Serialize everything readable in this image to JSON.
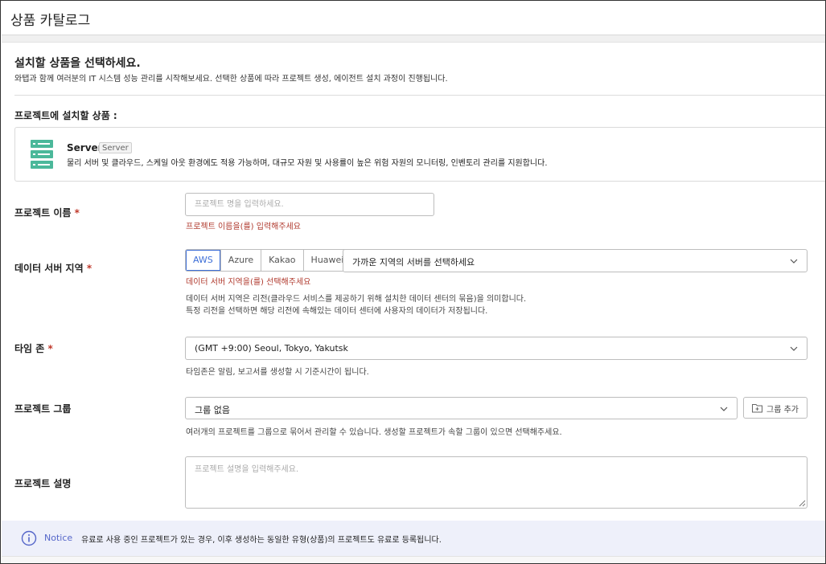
{
  "app": {
    "title": "상품 카탈로그"
  },
  "intro": {
    "heading": "설치할 상품을 선택하세요.",
    "subheading": "와탭과 함께 여러분의 IT 시스템 성능 관리를 시작해보세요. 선택한 상품에 따라 프로젝트 생성, 에이전트 설치 과정이 진행됩니다."
  },
  "install": {
    "label": "프로젝트에 설치할 상품 :",
    "product": {
      "icon": "server-icon",
      "name": "Server",
      "badge": "Server",
      "description": "물리 서버 및 클라우드, 스케일 아웃 환경에도 적용 가능하며, 대규모 자원 및 사용률이 높은 위험 자원의 모니터링, 인벤토리 관리를 지원합니다.",
      "icon_color": "#4bb89a"
    }
  },
  "form": {
    "required_mark": "*",
    "project_name": {
      "label": "프로젝트 이름",
      "placeholder": "프로젝트 명을 입력하세요.",
      "value": "",
      "error": "프로젝트 이름을(를) 입력해주세요"
    },
    "region": {
      "label": "데이터 서버 지역",
      "providers": [
        "AWS",
        "Azure",
        "Kakao",
        "Huawei"
      ],
      "selected_provider": "AWS",
      "select_text": "가까운 지역의 서버를 선택하세요",
      "error": "데이터 서버 지역을(를) 선택해주세요",
      "help_line1": "데이터 서버 지역은 리전(클라우드 서비스를 제공하기 위해 설치한 데이터 센터의 묶음)을 의미합니다.",
      "help_line2": "특정 리전을 선택하면 해당 리전에 속해있는 데이터 센터에 사용자의 데이터가 저장됩니다."
    },
    "timezone": {
      "label": "타임 존",
      "value": "(GMT +9:00) Seoul, Tokyo, Yakutsk",
      "help": "타임존은 알림, 보고서를 생성할 시 기준시간이 됩니다."
    },
    "group": {
      "label": "프로젝트 그룹",
      "value": "그룹 없음",
      "add_button": "그룹 추가",
      "help": "여러개의 프로젝트를 그룹으로 묶어서 관리할 수 있습니다. 생성할 프로젝트가 속할 그룹이 있으면 선택해주세요."
    },
    "description": {
      "label": "프로젝트 설명",
      "placeholder": "프로젝트 설명을 입력해주세요.",
      "value": ""
    }
  },
  "notice": {
    "icon": "info-icon",
    "label": "Notice",
    "text": "유료로 사용 중인 프로젝트가 있는 경우, 이후 생성하는 동일한 유형(상품)의 프로젝트도 유료로 등록됩니다."
  },
  "colors": {
    "accent": "#3e6fd8",
    "error": "#b03a2e",
    "notice_bg": "#eef0fa"
  }
}
